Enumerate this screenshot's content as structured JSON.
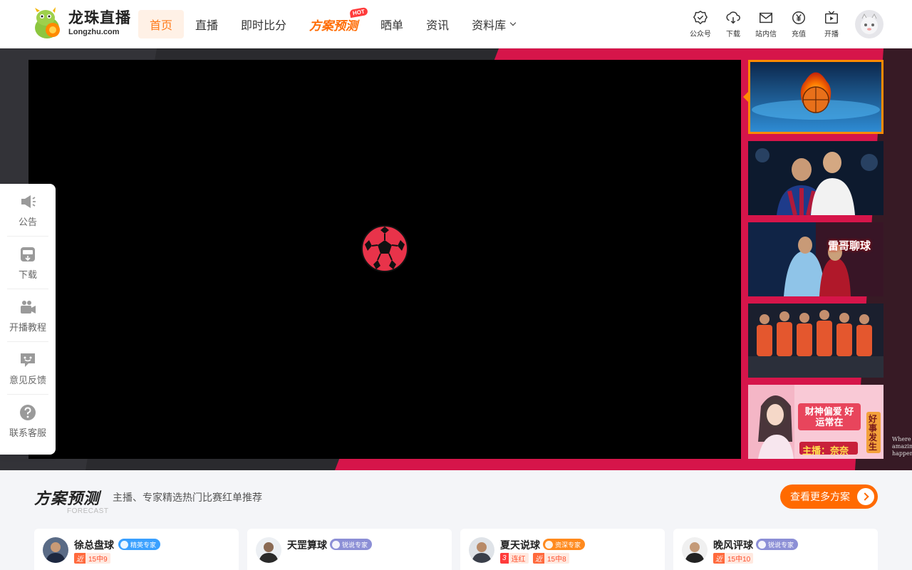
{
  "brand": {
    "title": "龙珠直播",
    "subtitle": "Longzhu.com"
  },
  "nav": {
    "items": [
      {
        "label": "首页",
        "active": true
      },
      {
        "label": "直播"
      },
      {
        "label": "即时比分"
      },
      {
        "label": "方案预测",
        "badge": "HOT"
      },
      {
        "label": "晒单"
      },
      {
        "label": "资讯"
      },
      {
        "label": "资料库",
        "has_dropdown": true
      }
    ]
  },
  "toolbar": [
    {
      "label": "公众号",
      "icon": "badge-check-icon"
    },
    {
      "label": "下载",
      "icon": "cloud-download-icon"
    },
    {
      "label": "站内信",
      "icon": "mail-icon"
    },
    {
      "label": "充值",
      "icon": "yen-coin-icon"
    },
    {
      "label": "开播",
      "icon": "tv-icon"
    }
  ],
  "hero": {
    "loading_icon": "soccer-ball-icon",
    "thumbnails": [
      {
        "title": "",
        "active": true,
        "scene": "flaming-basketball"
      },
      {
        "title": "",
        "scene": "two-footballers"
      },
      {
        "title": "雷哥聊球",
        "scene": "football-stars-banner"
      },
      {
        "title": "",
        "scene": "orange-team-lineup"
      },
      {
        "title": "财神偏爱 好运常在",
        "host_label": "主播：奈奈",
        "side_text": "好事发生",
        "scene": "anchor-promo"
      }
    ],
    "edge_text": "Where amazing happens"
  },
  "sidebar": [
    {
      "label": "公告",
      "icon": "megaphone-icon"
    },
    {
      "label": "下载",
      "icon": "app-download-icon"
    },
    {
      "label": "开播教程",
      "icon": "video-camera-icon"
    },
    {
      "label": "意见反馈",
      "icon": "feedback-icon"
    },
    {
      "label": "联系客服",
      "icon": "help-icon"
    }
  ],
  "forecast": {
    "title": "方案预测",
    "title_en": "FORECAST",
    "description": "主播、专家精选热门比赛红单推荐",
    "more_label": "查看更多方案",
    "colors": {
      "accent": "#ff6a00",
      "hero_red": "#d6154a"
    },
    "experts": [
      {
        "name": "徐总盘球",
        "tag": "精英专家",
        "tag_color": "#3aa0ff",
        "stats": [
          {
            "k": "近",
            "v": "15中9"
          }
        ]
      },
      {
        "name": "天罡算球",
        "tag": "锐说专家",
        "tag_color": "#8c8fd6",
        "stats": []
      },
      {
        "name": "夏天说球",
        "tag": "资深专家",
        "tag_color": "#ff8a1e",
        "stats": [
          {
            "k": "3",
            "v": "连红"
          },
          {
            "k": "近",
            "v": "15中8"
          }
        ]
      },
      {
        "name": "晚风评球",
        "tag": "锐说专家",
        "tag_color": "#8c8fd6",
        "stats": [
          {
            "k": "近",
            "v": "15中10"
          }
        ]
      }
    ]
  }
}
